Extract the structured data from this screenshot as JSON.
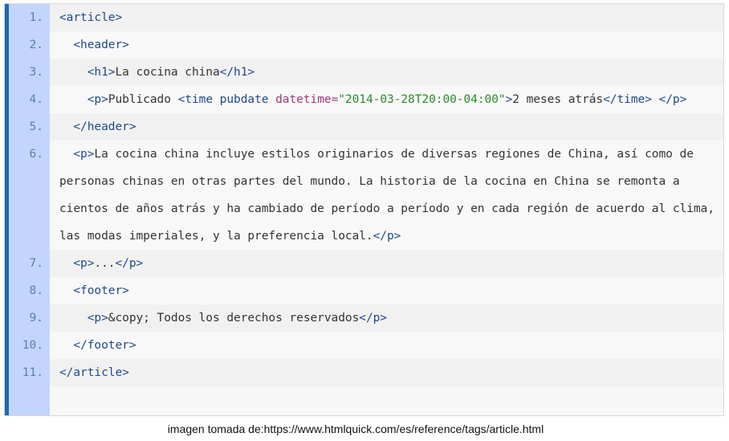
{
  "code_block": {
    "lines": [
      {
        "n": "1.",
        "tokens": [
          {
            "t": "tag",
            "v": "<article>"
          }
        ]
      },
      {
        "n": "2.",
        "tokens": [
          {
            "t": "tag",
            "v": "  <header>"
          }
        ]
      },
      {
        "n": "3.",
        "tokens": [
          {
            "t": "tag",
            "v": "    <h1>"
          },
          {
            "t": "txt",
            "v": "La cocina china"
          },
          {
            "t": "tag",
            "v": "</h1>"
          }
        ]
      },
      {
        "n": "4.",
        "tokens": [
          {
            "t": "tag",
            "v": "    <p>"
          },
          {
            "t": "txt",
            "v": "Publicado "
          },
          {
            "t": "tag",
            "v": "<time pubdate "
          },
          {
            "t": "attr",
            "v": "datetime="
          },
          {
            "t": "val",
            "v": "\"2014-03-28T20:00-04:00\""
          },
          {
            "t": "tag",
            "v": ">"
          },
          {
            "t": "txt",
            "v": "2 meses atrás"
          },
          {
            "t": "tag",
            "v": "</time> </p>"
          }
        ]
      },
      {
        "n": "5.",
        "tokens": [
          {
            "t": "tag",
            "v": "  </header>"
          }
        ]
      },
      {
        "n": "6.",
        "tokens": [
          {
            "t": "tag",
            "v": "  <p>"
          },
          {
            "t": "txt",
            "v": "La cocina china incluye estilos originarios de diversas regiones de China, así como de personas chinas en otras partes del mundo. La historia de la cocina en China se remonta a cientos de años atrás y ha cambiado de período a período y en cada región de acuerdo al clima, las modas imperiales, y la preferencia local."
          },
          {
            "t": "tag",
            "v": "</p>"
          }
        ]
      },
      {
        "n": "7.",
        "tokens": [
          {
            "t": "tag",
            "v": "  <p>"
          },
          {
            "t": "txt",
            "v": "..."
          },
          {
            "t": "tag",
            "v": "</p>"
          }
        ]
      },
      {
        "n": "8.",
        "tokens": [
          {
            "t": "tag",
            "v": "  <footer>"
          }
        ]
      },
      {
        "n": "9.",
        "tokens": [
          {
            "t": "tag",
            "v": "    <p>"
          },
          {
            "t": "txt",
            "v": "&copy; Todos los derechos reservados"
          },
          {
            "t": "tag",
            "v": "</p>"
          }
        ]
      },
      {
        "n": "10.",
        "tokens": [
          {
            "t": "tag",
            "v": "  </footer>"
          }
        ]
      },
      {
        "n": "11.",
        "tokens": [
          {
            "t": "tag",
            "v": "</article>"
          }
        ]
      }
    ]
  },
  "caption": "imagen tomada de:https://www.htmlquick.com/es/reference/tags/article.html",
  "colors": {
    "accent_bar": "#1e69b0",
    "gutter": "#c3d5fc",
    "tag": "#1f4a8a",
    "attribute": "#a0387a",
    "string": "#2b8a2b",
    "text": "#333333"
  }
}
